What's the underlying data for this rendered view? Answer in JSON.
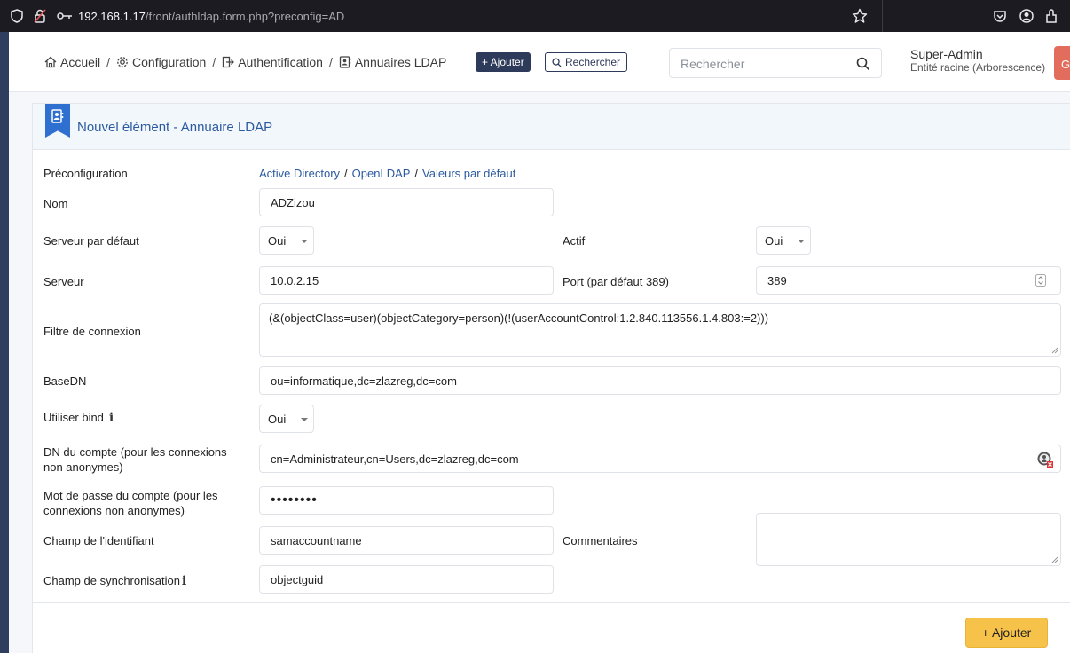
{
  "browser": {
    "url_host": "192.168.1.17",
    "url_path": "/front/authldap.form.php?preconfig=AD"
  },
  "breadcrumb": {
    "home": "Accueil",
    "configuration": "Configuration",
    "authentification": "Authentification",
    "annuaires": "Annuaires LDAP"
  },
  "toolbar": {
    "add_label": "+ Ajouter",
    "search_label": "Rechercher"
  },
  "search": {
    "placeholder": "Rechercher"
  },
  "user": {
    "name": "Super-Admin",
    "entity": "Entité racine (Arborescence)",
    "avatar_initials": "GL"
  },
  "form": {
    "title": "Nouvel élément - Annuaire LDAP",
    "preconfig_label": "Préconfiguration",
    "preconfig_links": [
      "Active Directory",
      "OpenLDAP",
      "Valeurs par défaut"
    ],
    "nom_label": "Nom",
    "nom_value": "ADZizou",
    "serveur_defaut_label": "Serveur par défaut",
    "serveur_defaut_value": "Oui",
    "actif_label": "Actif",
    "actif_value": "Oui",
    "serveur_label": "Serveur",
    "serveur_value": "10.0.2.15",
    "port_label": "Port (par défaut 389)",
    "port_value": "389",
    "filtre_label": "Filtre de connexion",
    "filtre_value": "(&(objectClass=user)(objectCategory=person)(!(userAccountControl:1.2.840.113556.1.4.803:=2)))",
    "basedn_label": "BaseDN",
    "basedn_value": "ou=informatique,dc=zlazreg,dc=com",
    "bind_label": "Utiliser bind",
    "bind_value": "Oui",
    "info_glyph": "i",
    "dn_label_1": "DN du compte (pour les connexions",
    "dn_label_2": "non anonymes)",
    "dn_value": "cn=Administrateur,cn=Users,dc=zlazreg,dc=com",
    "pwd_label_1": "Mot de passe du compte (pour les",
    "pwd_label_2": "connexions non anonymes)",
    "pwd_value": "••••••••",
    "login_field_label": "Champ de l'identifiant",
    "login_field_value": "samaccountname",
    "comments_label": "Commentaires",
    "sync_label": "Champ de synchronisation",
    "sync_value": "objectguid",
    "submit_label": "+ Ajouter"
  },
  "colors": {
    "accent": "#2c5aa0",
    "primary_button": "#f7c24a",
    "nav_dark": "#2e3a59",
    "avatar": "#e36d5c"
  }
}
